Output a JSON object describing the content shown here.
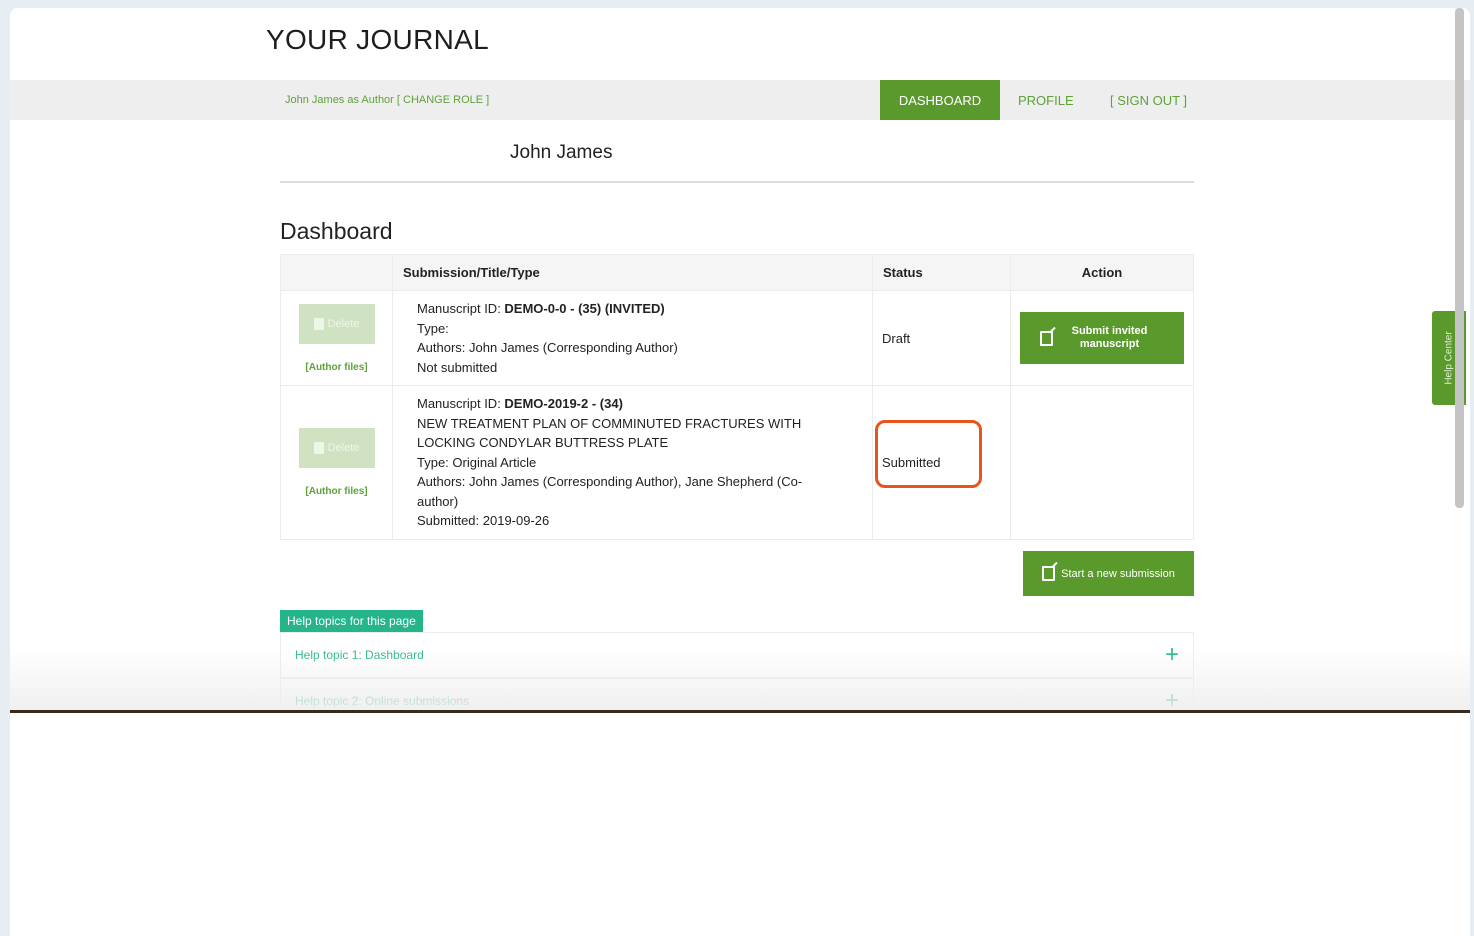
{
  "header": {
    "journal_title": "YOUR JOURNAL"
  },
  "nav": {
    "role_line": "John James as Author [ CHANGE ROLE ]",
    "dashboard": "DASHBOARD",
    "profile": "PROFILE",
    "sign_out": "[ SIGN OUT ]"
  },
  "user": {
    "name": "John James"
  },
  "dashboard": {
    "title": "Dashboard",
    "columns": {
      "submission": "Submission/Title/Type",
      "status": "Status",
      "action": "Action"
    },
    "rows": [
      {
        "delete_label": "Delete",
        "author_files": "[Author files]",
        "id_prefix": "Manuscript ID: ",
        "id": "DEMO-0-0 - (35) (INVITED)",
        "lines": [
          "Type:",
          "Authors: John James (Corresponding Author)",
          "Not submitted"
        ],
        "status": "Draft",
        "action_label": "Submit invited manuscript"
      },
      {
        "delete_label": "Delete",
        "author_files": "[Author files]",
        "id_prefix": "Manuscript ID: ",
        "id": "DEMO-2019-2 - (34)",
        "lines": [
          "NEW TREATMENT PLAN OF COMMINUTED FRACTURES WITH",
          "LOCKING CONDYLAR BUTTRESS PLATE",
          "Type: Original Article",
          "Authors: John James (Corresponding Author), Jane Shepherd (Co-",
          "author)",
          "Submitted: 2019-09-26"
        ],
        "status": "Submitted"
      }
    ],
    "new_submission": "Start a new submission"
  },
  "help": {
    "badge": "Help topics for this page",
    "topics": [
      "Help topic 1: Dashboard",
      "Help topic 2: Online submissions"
    ]
  },
  "help_center": "Help Center",
  "colors": {
    "brand_green": "#5a9a2c",
    "teal": "#26b58a",
    "highlight": "#e8541a"
  }
}
